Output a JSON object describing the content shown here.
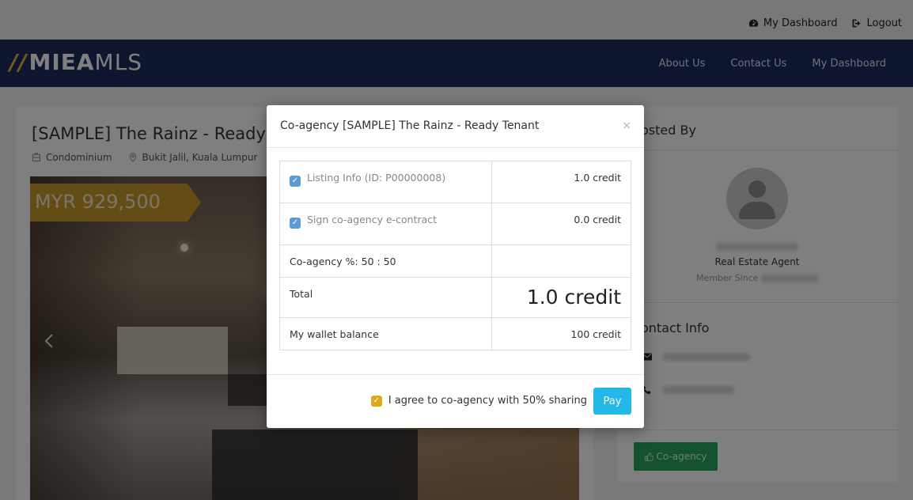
{
  "topbar": {
    "dashboard_label": "My Dashboard",
    "logout_label": "Logout"
  },
  "navbar": {
    "logo_main": "MIEA",
    "logo_suffix": "MLS",
    "links": [
      "About Us",
      "Contact Us",
      "My Dashboard"
    ]
  },
  "listing": {
    "title": "[SAMPLE] The Rainz - Ready",
    "property_type": "Condominium",
    "location": "Bukit Jalil, Kuala Lumpur",
    "price": "MYR 929,500"
  },
  "sidebar": {
    "posted_by_heading": "osted By",
    "agent_role": "Real Estate Agent",
    "member_since_label": "Member Since",
    "contact_heading": "ontact Info",
    "coagency_button": "Co-agency"
  },
  "modal": {
    "title": "Co-agency [SAMPLE] The Rainz - Ready Tenant",
    "close_symbol": "×",
    "rows": [
      {
        "label": "Listing Info (ID: P00000008)",
        "value": "1.0 credit"
      },
      {
        "label": "Sign co-agency e-contract",
        "value": "0.0 credit"
      },
      {
        "label": "Co-agency %: 50 : 50",
        "value": ""
      },
      {
        "label": "Total",
        "value": "1.0 credit"
      },
      {
        "label": "My wallet balance",
        "value": "100 credit"
      }
    ],
    "agree_label": "I agree to co-agency with 50% sharing",
    "pay_button": "Pay"
  },
  "colors": {
    "navbar": "#1d2a5e",
    "price_tag": "#c99a2a",
    "pay_button": "#23b8e8",
    "coagency_button": "#27a559",
    "agree_checkbox": "#e0a81e",
    "row_checkbox": "#5b9bd5"
  },
  "icons": {
    "topbar_dashboard": "tachometer-icon",
    "topbar_logout": "sign-out-icon",
    "property_type": "building-icon",
    "location": "map-marker-icon",
    "carousel_prev": "chevron-left-icon",
    "email": "envelope-icon",
    "phone": "phone-icon",
    "coagency": "thumbs-up-icon",
    "close": "close-icon"
  }
}
